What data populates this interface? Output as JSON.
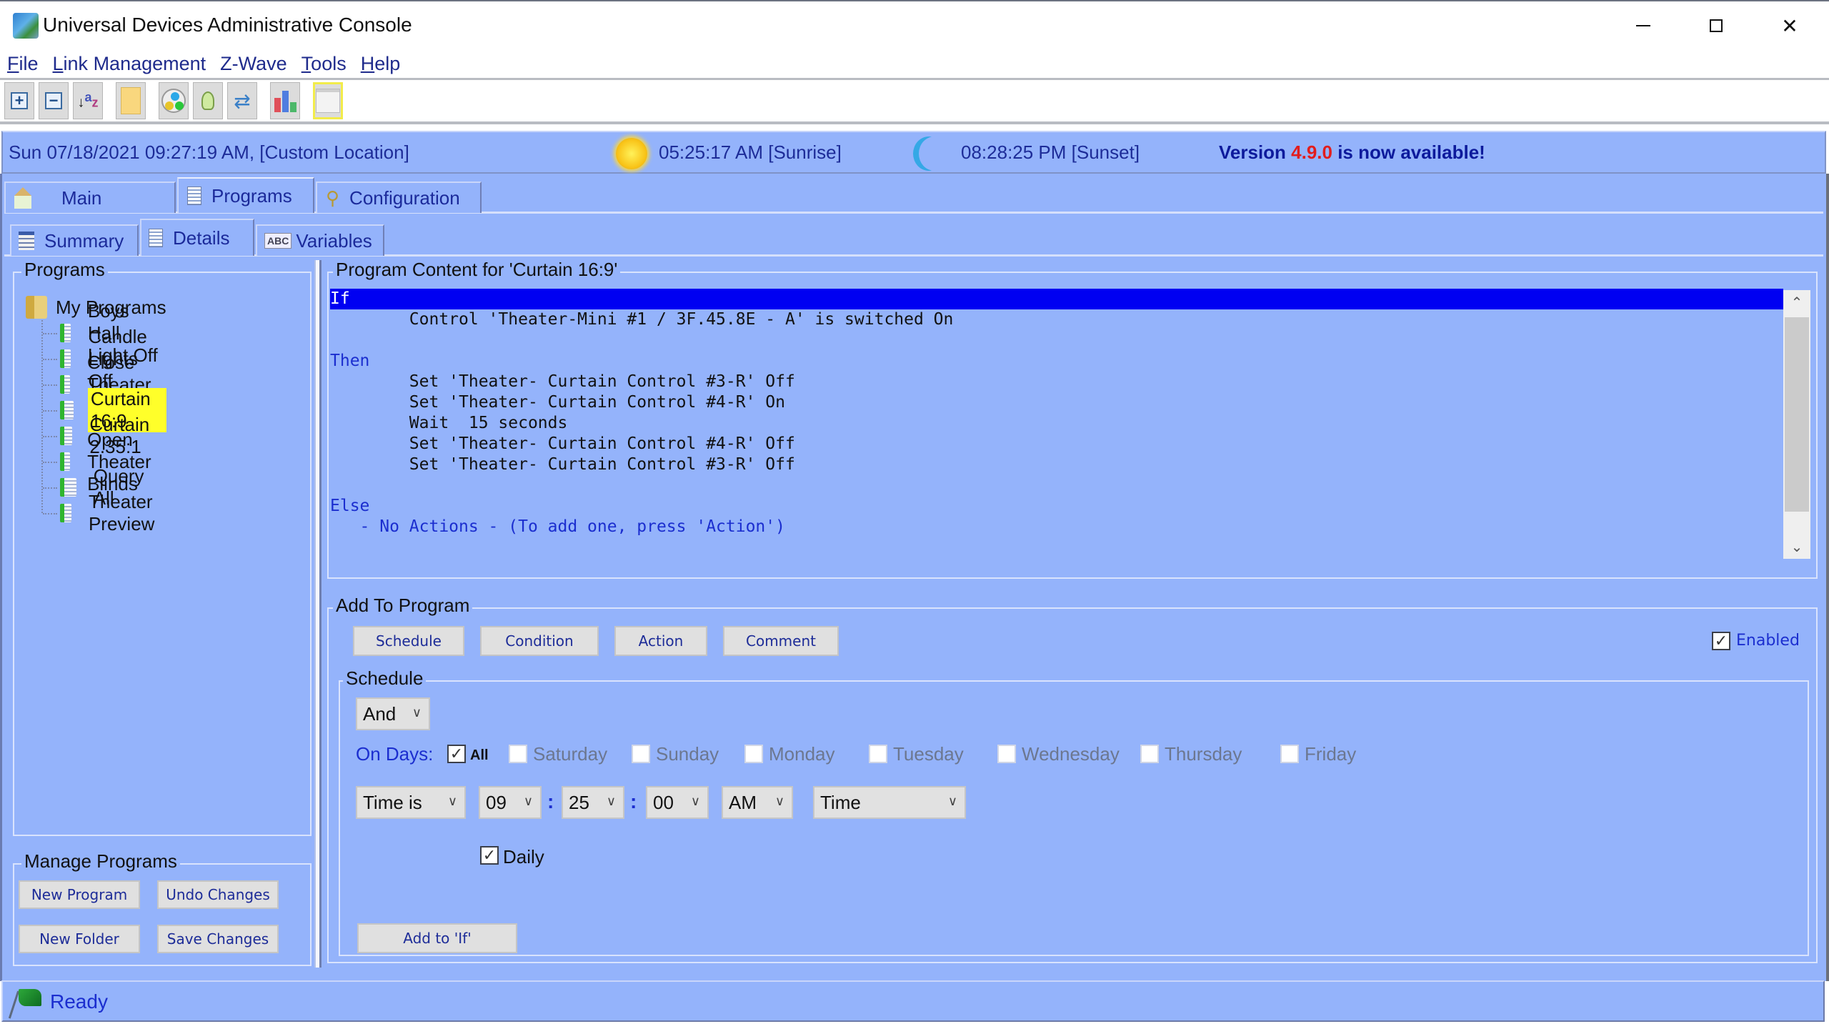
{
  "window": {
    "title": "Universal Devices Administrative Console",
    "controls": {
      "minimize": "minimize",
      "maximize": "maximize",
      "close": "✕"
    }
  },
  "menu": [
    {
      "label": "File",
      "mnemonic": "F"
    },
    {
      "label": "Link Management",
      "mnemonic": "L"
    },
    {
      "label": "Z-Wave",
      "mnemonic": ""
    },
    {
      "label": "Tools",
      "mnemonic": "T"
    },
    {
      "label": "Help",
      "mnemonic": "H"
    }
  ],
  "toolbar": [
    {
      "name": "expand-all",
      "icon": "plus-icon"
    },
    {
      "name": "collapse-all",
      "icon": "minus-icon"
    },
    {
      "name": "sort",
      "icon": "sort-az-icon"
    },
    {
      "name": "notes",
      "icon": "note-icon"
    },
    {
      "name": "scenes",
      "icon": "scene-icon"
    },
    {
      "name": "lighting",
      "icon": "bulb-icon"
    },
    {
      "name": "refresh",
      "icon": "sync-icon"
    },
    {
      "name": "reports",
      "icon": "chart-icon"
    },
    {
      "name": "blank",
      "icon": "window-icon",
      "highlighted": true
    }
  ],
  "infobar": {
    "datetime": "Sun 07/18/2021 09:27:19 AM,  [Custom Location]",
    "sunrise": "05:25:17 AM [Sunrise]",
    "sunset": "08:28:25 PM [Sunset]",
    "version_prefix": "Version ",
    "version_number": "4.9.0",
    "version_suffix": " is now available!"
  },
  "tabs": [
    {
      "label": "Main",
      "active": false
    },
    {
      "label": "Programs",
      "active": true
    },
    {
      "label": "Configuration",
      "active": false
    }
  ],
  "subtabs": [
    {
      "label": "Summary",
      "active": false
    },
    {
      "label": "Details",
      "active": true
    },
    {
      "label": "Variables",
      "active": false
    }
  ],
  "programs": {
    "legend": "Programs",
    "root": "My Programs",
    "items": [
      {
        "label": "Boys Hall Light Off",
        "selected": false
      },
      {
        "label": "Candle Lights Off",
        "selected": false
      },
      {
        "label": "Close Theater Blinds",
        "selected": false
      },
      {
        "label": "Curtain 16:9",
        "selected": true
      },
      {
        "label": "Curtain 2.35:1",
        "selected": false
      },
      {
        "label": "Open Theater Blinds",
        "selected": false
      },
      {
        "label": "Query All",
        "selected": false
      },
      {
        "label": "Theater Preview",
        "selected": false
      }
    ]
  },
  "manage": {
    "legend": "Manage Programs",
    "new_program": "New Program",
    "undo_changes": "Undo Changes",
    "new_folder": "New Folder",
    "save_changes": "Save Changes"
  },
  "content": {
    "legend": "Program Content for 'Curtain 16:9'",
    "lines": [
      {
        "text": "If",
        "type": "sel"
      },
      {
        "text": "        Control 'Theater-Mini #1 / 3F.45.8E - A' is switched On",
        "type": "normal"
      },
      {
        "text": "",
        "type": "blank"
      },
      {
        "text": "Then",
        "type": "kw"
      },
      {
        "text": "        Set 'Theater- Curtain Control #3-R' Off",
        "type": "normal"
      },
      {
        "text": "        Set 'Theater- Curtain Control #4-R' On",
        "type": "normal"
      },
      {
        "text": "        Wait  15 seconds",
        "type": "normal"
      },
      {
        "text": "        Set 'Theater- Curtain Control #4-R' Off",
        "type": "normal"
      },
      {
        "text": "        Set 'Theater- Curtain Control #3-R' Off",
        "type": "normal"
      },
      {
        "text": "",
        "type": "blank"
      },
      {
        "text": "Else",
        "type": "kw"
      },
      {
        "text": "   - No Actions - (To add one, press 'Action')",
        "type": "note"
      }
    ]
  },
  "add_to_program": {
    "legend": "Add To Program",
    "buttons": [
      "Schedule",
      "Condition",
      "Action",
      "Comment"
    ],
    "enabled_label": "Enabled",
    "enabled": true
  },
  "schedule": {
    "legend": "Schedule",
    "logic": "And",
    "on_days_label": "On Days:",
    "all_label": "All",
    "all_checked": true,
    "days": [
      "Saturday",
      "Sunday",
      "Monday",
      "Tuesday",
      "Wednesday",
      "Thursday",
      "Friday"
    ],
    "time_mode": "Time is",
    "hour": "09",
    "minute": "25",
    "second": "00",
    "ampm": "AM",
    "time_type": "Time",
    "daily_label": "Daily",
    "daily_checked": true,
    "add_button": "Add to 'If'"
  },
  "status": {
    "text": "Ready"
  },
  "colors": {
    "panel_bg": "#94b3fb",
    "accent_text": "#1b2ecf",
    "selection": "#0000f2",
    "tree_highlight": "#ffff2a",
    "version_highlight": "#e21d1d"
  }
}
